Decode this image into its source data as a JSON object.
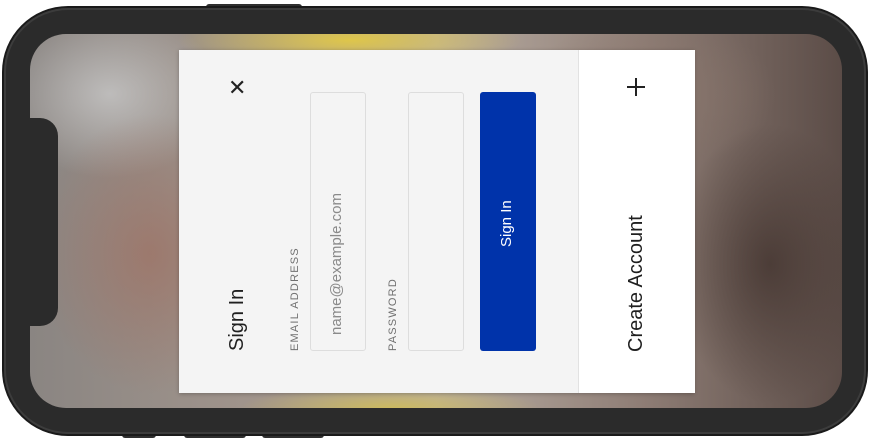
{
  "signin": {
    "title": "Sign In",
    "close_icon": "close-icon",
    "email_label": "EMAIL ADDRESS",
    "email_placeholder": "name@example.com",
    "email_value": "",
    "password_label": "PASSWORD",
    "password_value": "",
    "submit_label": "Sign In"
  },
  "create_account": {
    "label": "Create Account",
    "icon": "plus-icon"
  },
  "colors": {
    "primary_button": "#0033aa",
    "modal_background": "#f4f4f4",
    "panel_background": "#ffffff"
  }
}
